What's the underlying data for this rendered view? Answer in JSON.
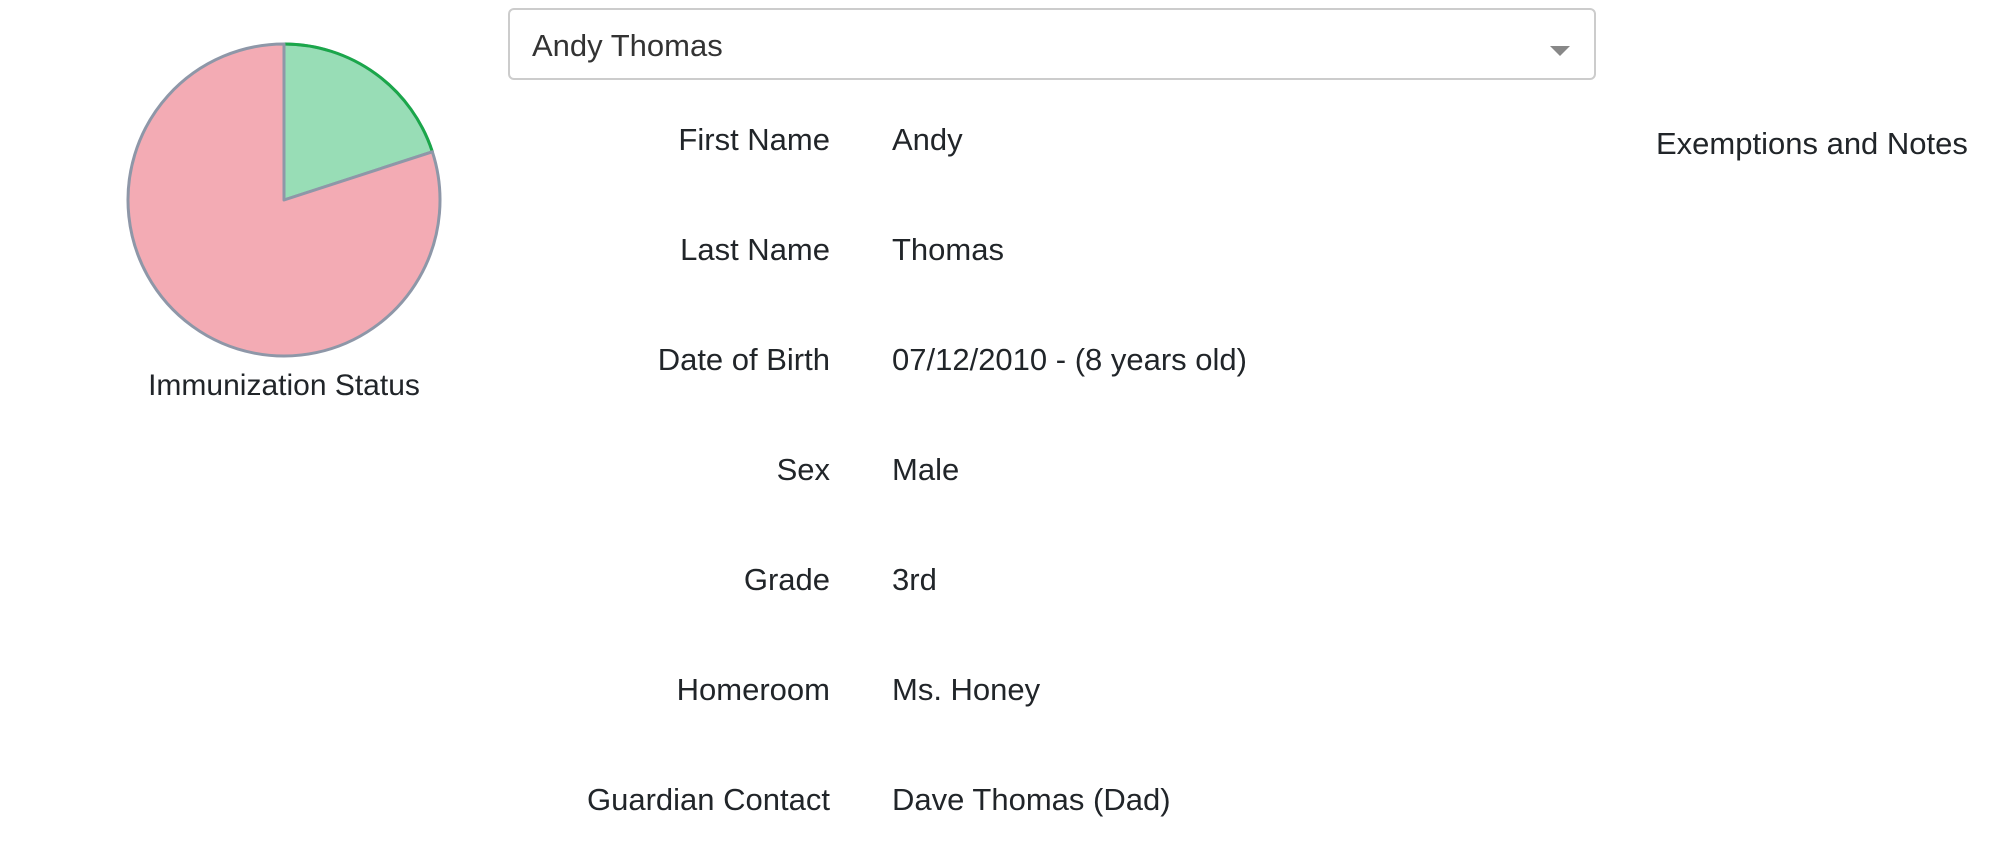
{
  "immunization_chart": {
    "caption": "Immunization Status",
    "colors": {
      "complete": "#98ddb6",
      "complete_outline": "#1aa74a",
      "incomplete": "#f3abb4",
      "outline": "#8e97a8"
    }
  },
  "chart_data": {
    "type": "pie",
    "title": "Immunization Status",
    "slices": [
      {
        "value": 0.2,
        "color": "#98ddb6"
      },
      {
        "value": 0.8,
        "color": "#f3abb4"
      }
    ]
  },
  "student_select": {
    "selected": "Andy Thomas",
    "icon": "chevron-down-icon"
  },
  "student": {
    "fields": [
      {
        "label": "First Name",
        "value": "Andy"
      },
      {
        "label": "Last Name",
        "value": "Thomas"
      },
      {
        "label": "Date of Birth",
        "value": "07/12/2010 - (8 years old)"
      },
      {
        "label": "Sex",
        "value": "Male"
      },
      {
        "label": "Grade",
        "value": "3rd"
      },
      {
        "label": "Homeroom",
        "value": "Ms. Honey"
      },
      {
        "label": "Guardian Contact",
        "value": "Dave Thomas (Dad)"
      }
    ]
  },
  "exemptions": {
    "title": "Exemptions and Notes"
  }
}
